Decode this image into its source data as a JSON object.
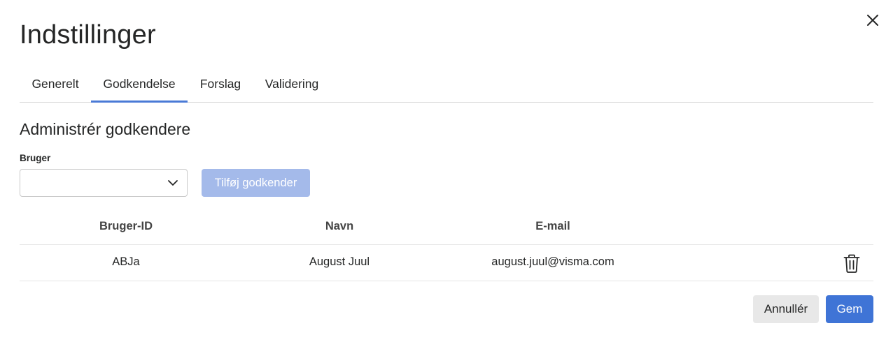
{
  "dialog": {
    "title": "Indstillinger",
    "close_icon": "close-icon"
  },
  "tabs": [
    {
      "label": "Generelt",
      "active": false
    },
    {
      "label": "Godkendelse",
      "active": true
    },
    {
      "label": "Forslag",
      "active": false
    },
    {
      "label": "Validering",
      "active": false
    }
  ],
  "approvers": {
    "section_title": "Administrér godkendere",
    "user_field_label": "Bruger",
    "user_select_value": "",
    "add_button_label": "Tilføj godkender",
    "table": {
      "columns": [
        "Bruger-ID",
        "Navn",
        "E-mail"
      ],
      "rows": [
        {
          "user_id": "ABJa",
          "name": "August Juul",
          "email": "august.juul@visma.com",
          "action_icon": "trash-icon"
        }
      ]
    }
  },
  "footer": {
    "cancel_label": "Annullér",
    "save_label": "Gem"
  },
  "colors": {
    "accent": "#3f74d6",
    "tab_underline": "#4a7ad6",
    "disabled_button": "#a4baea",
    "cancel_bg": "#e8e8e8"
  }
}
